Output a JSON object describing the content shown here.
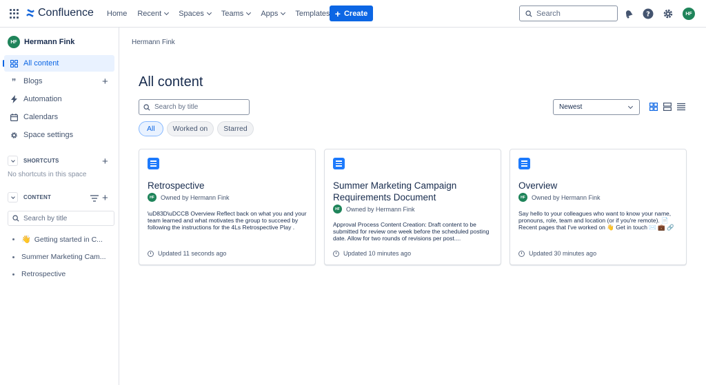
{
  "topbar": {
    "app_name": "Confluence",
    "nav": [
      {
        "label": "Home",
        "dropdown": false
      },
      {
        "label": "Recent",
        "dropdown": true
      },
      {
        "label": "Spaces",
        "dropdown": true
      },
      {
        "label": "Teams",
        "dropdown": true
      },
      {
        "label": "Apps",
        "dropdown": true
      },
      {
        "label": "Templates",
        "dropdown": false
      }
    ],
    "create_label": "Create",
    "search_placeholder": "Search",
    "user_initials": "HF",
    "icons": [
      "app-switcher-icon",
      "notifications-icon",
      "help-icon",
      "settings-icon"
    ],
    "accent": "#0C66E4"
  },
  "sidebar": {
    "space_initials": "HF",
    "space_name": "Hermann Fink",
    "items": [
      {
        "label": "All content",
        "icon": "grid-icon",
        "active": true
      },
      {
        "label": "Blogs",
        "icon": "quote-icon",
        "active": false
      },
      {
        "label": "Automation",
        "icon": "lightning-icon",
        "active": false
      },
      {
        "label": "Calendars",
        "icon": "calendar-icon",
        "active": false
      },
      {
        "label": "Space settings",
        "icon": "gear-icon",
        "active": false
      }
    ],
    "shortcuts": {
      "title": "SHORTCUTS",
      "empty_text": "No shortcuts in this space"
    },
    "content": {
      "title": "CONTENT",
      "search_placeholder": "Search by title",
      "tree": [
        {
          "label": "Getting started in C...",
          "emoji": "👋"
        },
        {
          "label": "Summer Marketing Cam...",
          "emoji": ""
        },
        {
          "label": "Retrospective",
          "emoji": ""
        }
      ]
    }
  },
  "main": {
    "breadcrumb": "Hermann Fink",
    "title": "All content",
    "search_placeholder": "Search by title",
    "filters": [
      {
        "label": "All",
        "active": true
      },
      {
        "label": "Worked on",
        "active": false
      },
      {
        "label": "Starred",
        "active": false
      }
    ],
    "sort_value": "Newest",
    "view_modes": [
      "grid-view-icon",
      "compact-list-icon",
      "list-view-icon"
    ],
    "cards": [
      {
        "title": "Retrospective",
        "owner_initials": "HF",
        "owner": "Owned by Hermann Fink",
        "excerpt": "\\uD83D\\uDCCB  Overview Reflect back on what you and your team learned and what motivates the group to succeed by following the instructions for the 4Ls Retrospective Play . Team Team members Date...",
        "updated": "Updated 11 seconds ago"
      },
      {
        "title": "Summer Marketing Campaign Requirements Document",
        "owner_initials": "HF",
        "owner": "Owned by Hermann Fink",
        "excerpt": "Approval Process Content Creation: Draft content to be submitted for review one week before the scheduled posting date. Allow for two rounds of revisions per post....",
        "updated": "Updated 10 minutes ago"
      },
      {
        "title": "Overview",
        "owner_initials": "HF",
        "owner": "Owned by Hermann Fink",
        "excerpt": "Say hello to your colleagues who want to know your name, pronouns, role, team and location (or if you're remote). 📄 Recent pages that I've worked on 👋 Get in touch ✉️ 💼 🔗 👤 End with a bang! Some options are: \"I...",
        "updated": "Updated 30 minutes ago"
      }
    ]
  }
}
